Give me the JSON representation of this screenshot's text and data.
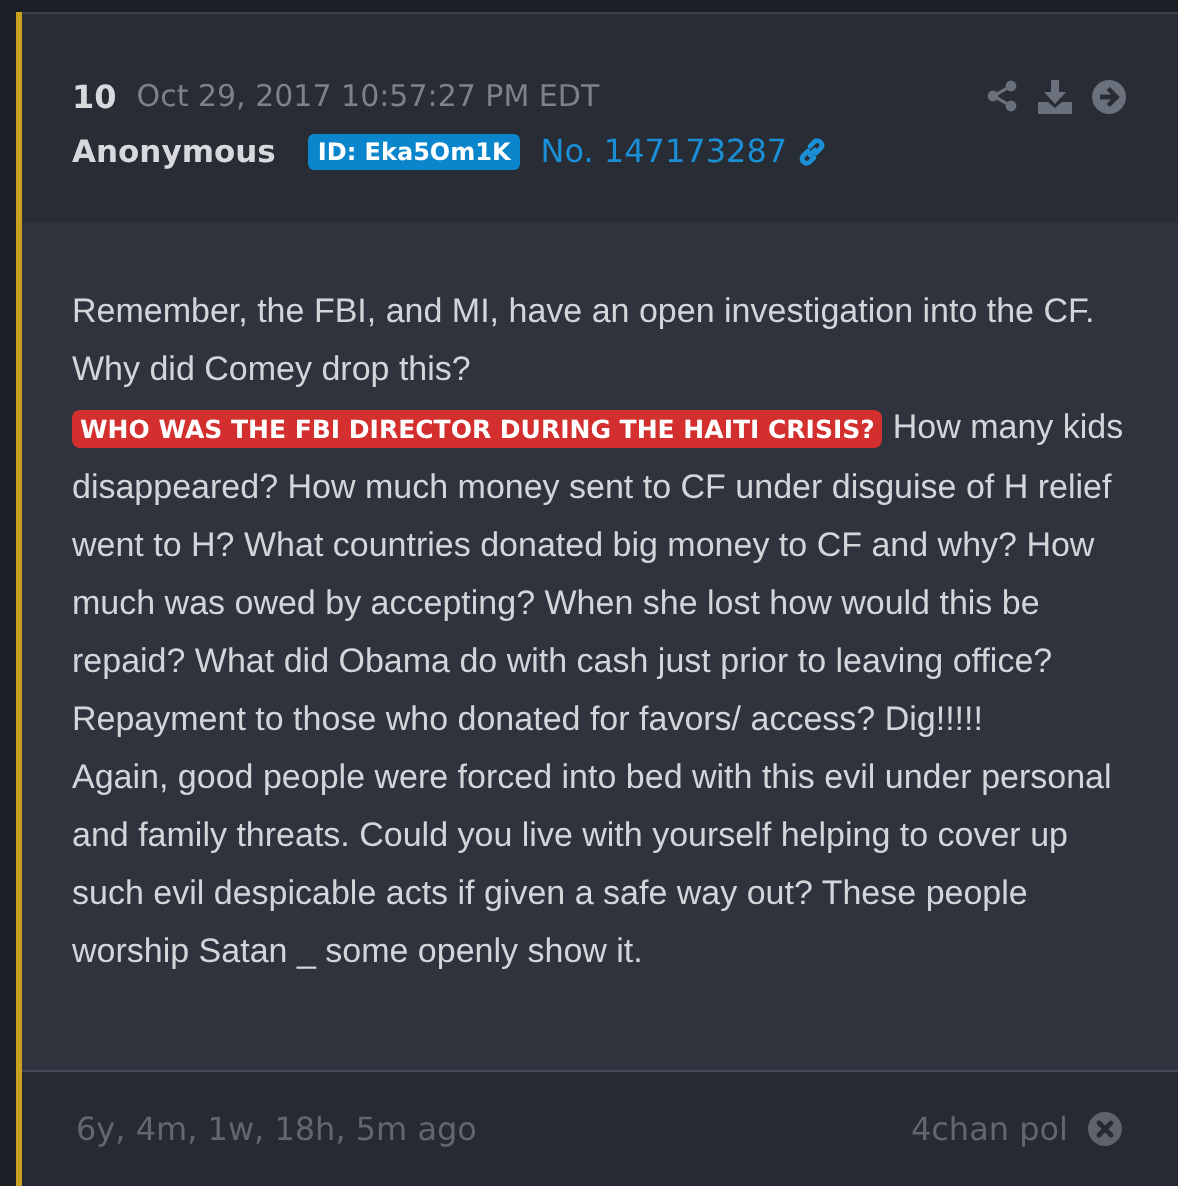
{
  "post": {
    "number": "10",
    "timestamp": "Oct 29, 2017 10:57:27 PM EDT",
    "author": "Anonymous",
    "id_badge": "ID: Eka5Om1K",
    "post_no": "No. 147173287"
  },
  "body": [
    {
      "segments": [
        {
          "kind": "text",
          "text": "Remember, the FBI, and MI, have an open investigation into the CF. Why did Comey drop this?"
        }
      ]
    },
    {
      "segments": [
        {
          "kind": "highlight",
          "text": "WHO WAS THE FBI DIRECTOR DURING THE HAITI CRISIS?"
        },
        {
          "kind": "text",
          "text": "How many kids disappeared? How much money sent to CF under disguise of H relief went to H? What countries donated big money to CF and why? How much was owed by accepting? When she lost how would this be repaid? What did Obama do with cash just prior to leaving office? Repayment to those who donated for favors/ access? Dig!!!!!"
        }
      ]
    },
    {
      "segments": [
        {
          "kind": "text",
          "text": "Again, good people were forced into bed with this evil under personal and family threats. Could you live with yourself helping to cover up such evil despicable acts if given a safe way out? These people worship Satan _ some openly show it."
        }
      ]
    }
  ],
  "footer": {
    "age": "6y, 4m, 1w, 18h, 5m ago",
    "source": "4chan pol"
  }
}
